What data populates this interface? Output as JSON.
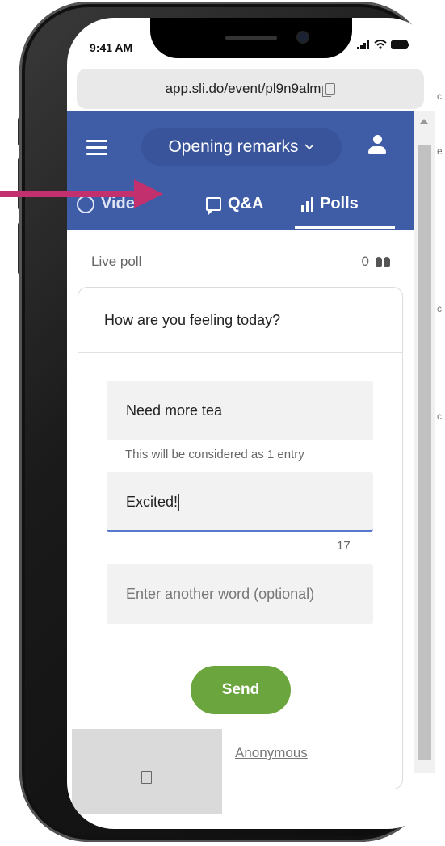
{
  "status_bar": {
    "time": "9:41 AM"
  },
  "browser": {
    "url": "app.sli.do/event/pl9n9alm"
  },
  "header": {
    "event_name": "Opening remarks",
    "tabs": [
      {
        "label": "Vide"
      },
      {
        "label": "Q&A"
      },
      {
        "label": "Polls"
      }
    ]
  },
  "poll": {
    "status": "Live poll",
    "participants": "0",
    "question": "How are you feeling today?",
    "entries": [
      {
        "value": "Need more tea",
        "note": "This will be considered as 1 entry"
      },
      {
        "value": "Excited!",
        "char_count": "17"
      },
      {
        "value": "",
        "placeholder": "Enter another word (optional)"
      }
    ],
    "send_label": "Send",
    "anonymous_label": "Anonymous"
  },
  "colors": {
    "header": "#3f5ca7",
    "send_button": "#6ba53e",
    "annotation_arrow": "#c2316d"
  }
}
